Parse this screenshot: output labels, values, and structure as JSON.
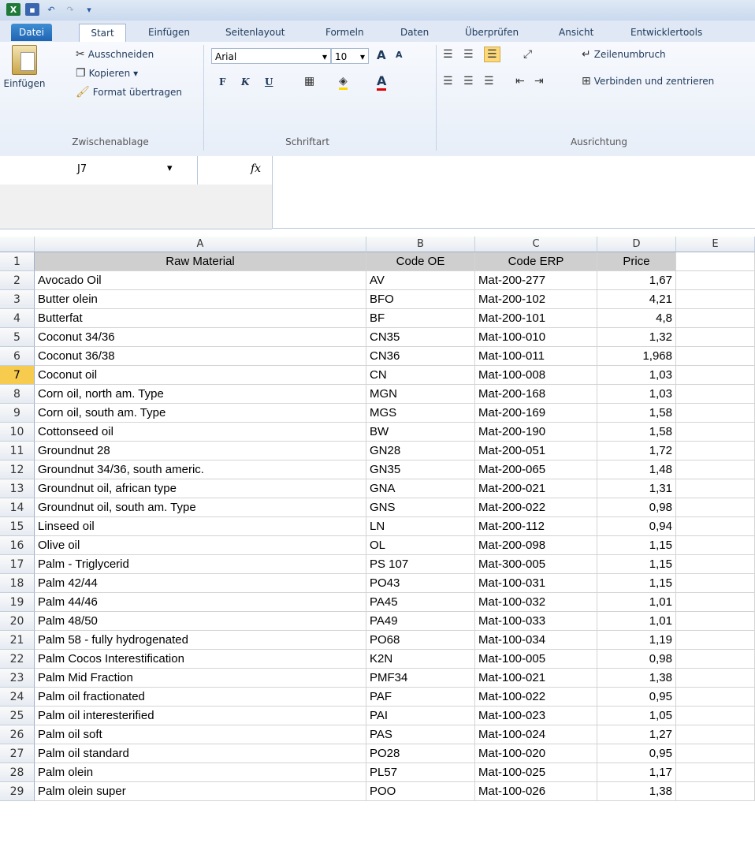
{
  "quick_access": {
    "excel_icon": "excel-icon",
    "save_icon": "save-icon",
    "undo_icon": "undo-icon",
    "redo_icon": "redo-icon"
  },
  "ribbon_tabs": [
    "Datei",
    "Start",
    "Einfügen",
    "Seitenlayout",
    "Formeln",
    "Daten",
    "Überprüfen",
    "Ansicht",
    "Entwicklertools"
  ],
  "clipboard": {
    "paste_label": "Einfügen",
    "cut": "Ausschneiden",
    "copy": "Kopieren",
    "format_painter": "Format übertragen",
    "group": "Zwischenablage"
  },
  "font": {
    "name": "Arial",
    "size": "10",
    "bold": "F",
    "italic": "K",
    "underline": "U",
    "group": "Schriftart"
  },
  "alignment": {
    "wrap": "Zeilenumbruch",
    "merge": "Verbinden und zentrieren",
    "group": "Ausrichtung"
  },
  "formula_bar": {
    "name_box": "J7",
    "fx": "fx"
  },
  "columns": [
    "A",
    "B",
    "C",
    "D",
    "E"
  ],
  "header_row": {
    "num": "1",
    "a": "Raw Material",
    "b": "Code OE",
    "c": "Code ERP",
    "d": "Price"
  },
  "rows": [
    {
      "n": "2",
      "a": "Avocado Oil",
      "b": "AV",
      "c": "Mat-200-277",
      "d": "1,67"
    },
    {
      "n": "3",
      "a": "Butter olein",
      "b": "BFO",
      "c": "Mat-200-102",
      "d": "4,21"
    },
    {
      "n": "4",
      "a": "Butterfat",
      "b": "BF",
      "c": "Mat-200-101",
      "d": "4,8"
    },
    {
      "n": "5",
      "a": "Coconut 34/36",
      "b": "CN35",
      "c": "Mat-100-010",
      "d": "1,32"
    },
    {
      "n": "6",
      "a": "Coconut 36/38",
      "b": "CN36",
      "c": "Mat-100-011",
      "d": "1,968"
    },
    {
      "n": "7",
      "a": "Coconut oil",
      "b": "CN",
      "c": "Mat-100-008",
      "d": "1,03"
    },
    {
      "n": "8",
      "a": "Corn oil, north am. Type",
      "b": "MGN",
      "c": "Mat-200-168",
      "d": "1,03"
    },
    {
      "n": "9",
      "a": "Corn oil, south am. Type",
      "b": "MGS",
      "c": "Mat-200-169",
      "d": "1,58"
    },
    {
      "n": "10",
      "a": "Cottonseed oil",
      "b": "BW",
      "c": "Mat-200-190",
      "d": "1,58"
    },
    {
      "n": "11",
      "a": "Groundnut 28",
      "b": "GN28",
      "c": "Mat-200-051",
      "d": "1,72"
    },
    {
      "n": "12",
      "a": "Groundnut 34/36, south americ.",
      "b": "GN35",
      "c": "Mat-200-065",
      "d": "1,48"
    },
    {
      "n": "13",
      "a": "Groundnut oil, african type",
      "b": "GNA",
      "c": "Mat-200-021",
      "d": "1,31"
    },
    {
      "n": "14",
      "a": "Groundnut oil, south am. Type",
      "b": "GNS",
      "c": "Mat-200-022",
      "d": "0,98"
    },
    {
      "n": "15",
      "a": "Linseed oil",
      "b": "LN",
      "c": "Mat-200-112",
      "d": "0,94"
    },
    {
      "n": "16",
      "a": "Olive oil",
      "b": "OL",
      "c": "Mat-200-098",
      "d": "1,15"
    },
    {
      "n": "17",
      "a": "Palm - Triglycerid",
      "b": "PS 107",
      "c": "Mat-300-005",
      "d": "1,15"
    },
    {
      "n": "18",
      "a": "Palm 42/44",
      "b": "PO43",
      "c": "Mat-100-031",
      "d": "1,15"
    },
    {
      "n": "19",
      "a": "Palm 44/46",
      "b": "PA45",
      "c": "Mat-100-032",
      "d": "1,01"
    },
    {
      "n": "20",
      "a": "Palm 48/50",
      "b": "PA49",
      "c": "Mat-100-033",
      "d": "1,01"
    },
    {
      "n": "21",
      "a": "Palm 58  - fully hydrogenated",
      "b": "PO68",
      "c": "Mat-100-034",
      "d": "1,19"
    },
    {
      "n": "22",
      "a": "Palm Cocos Interestification",
      "b": "K2N",
      "c": "Mat-100-005",
      "d": "0,98"
    },
    {
      "n": "23",
      "a": "Palm Mid Fraction",
      "b": "PMF34",
      "c": "Mat-100-021",
      "d": "1,38"
    },
    {
      "n": "24",
      "a": "Palm oil fractionated",
      "b": "PAF",
      "c": "Mat-100-022",
      "d": "0,95"
    },
    {
      "n": "25",
      "a": "Palm oil interesterified",
      "b": "PAI",
      "c": "Mat-100-023",
      "d": "1,05"
    },
    {
      "n": "26",
      "a": "Palm oil soft",
      "b": "PAS",
      "c": "Mat-100-024",
      "d": "1,27"
    },
    {
      "n": "27",
      "a": "Palm oil standard",
      "b": "PO28",
      "c": "Mat-100-020",
      "d": "0,95"
    },
    {
      "n": "28",
      "a": "Palm olein",
      "b": "PL57",
      "c": "Mat-100-025",
      "d": "1,17"
    },
    {
      "n": "29",
      "a": "Palm olein super",
      "b": "POO",
      "c": "Mat-100-026",
      "d": "1,38"
    }
  ],
  "selected_row": "7"
}
